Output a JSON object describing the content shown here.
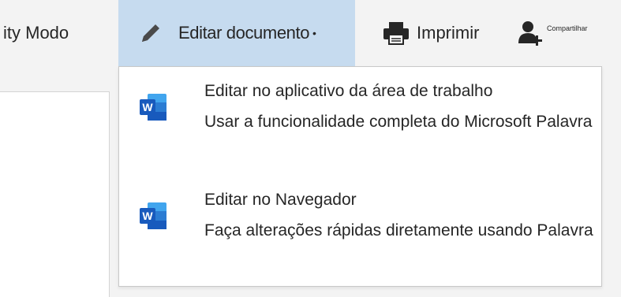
{
  "toolbar": {
    "mode_label": "ity Modo",
    "edit_label": "Editar documento",
    "edit_caret": "•",
    "print_label": "Imprimir",
    "share_label": "Compartilhar"
  },
  "edit_menu": {
    "items": [
      {
        "title": "Editar no aplicativo da área de trabalho",
        "description": "Usar a funcionalidade completa do Microsoft Palavra",
        "icon": "word-icon"
      },
      {
        "title": "Editar no Navegador",
        "description": "Faça alterações rápidas diretamente usando Palavra",
        "icon": "word-icon"
      }
    ]
  },
  "colors": {
    "active_button_bg": "#c6dbef",
    "word_blue": "#185abd",
    "word_light": "#41a5ee"
  }
}
